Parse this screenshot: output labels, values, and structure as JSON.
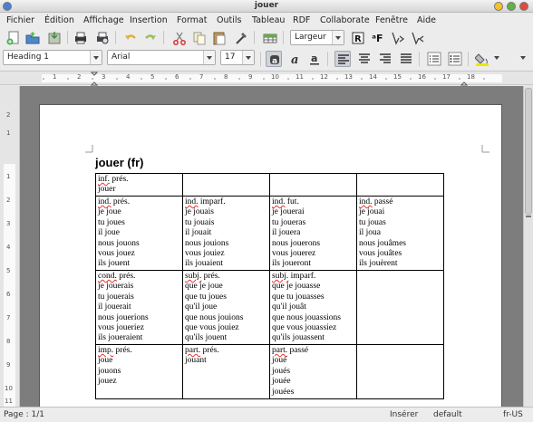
{
  "window": {
    "title": "jouer"
  },
  "menu": [
    "Fichier",
    "Édition",
    "Affichage",
    "Insertion",
    "Format",
    "Outils",
    "Tableau",
    "RDF",
    "Collaborate",
    "Fenêtre",
    "Aide"
  ],
  "toolbar": {
    "width_combo": "Largeur"
  },
  "format_toolbar": {
    "style": "Heading 1",
    "font": "Arial",
    "size": "17"
  },
  "ruler": {
    "h_labels": [
      "1",
      "2",
      "3",
      "4",
      "5",
      "6",
      "7",
      "8",
      "9",
      "10",
      "11",
      "12",
      "13",
      "14",
      "15",
      "16",
      "17",
      "18"
    ],
    "v_labels": [
      "2",
      "1",
      "1",
      "2",
      "3",
      "4",
      "5",
      "6",
      "7",
      "8",
      "9",
      "10",
      "11"
    ]
  },
  "document": {
    "heading_main": "jouer",
    "heading_lang": "(fr)",
    "rows": [
      [
        {
          "head": "inf. prés.",
          "lines": [
            "jouer"
          ]
        },
        {
          "head": "",
          "lines": []
        },
        {
          "head": "",
          "lines": []
        },
        {
          "head": "",
          "lines": []
        }
      ],
      [
        {
          "head": "ind. prés.",
          "lines": [
            "je joue",
            "tu joues",
            "il joue",
            "nous jouons",
            "vous jouez",
            "ils jouent"
          ]
        },
        {
          "head": "ind. imparf.",
          "lines": [
            "je jouais",
            "tu jouais",
            "il jouait",
            "nous jouions",
            "vous jouiez",
            "ils jouaient"
          ]
        },
        {
          "head": "ind. fut.",
          "lines": [
            "je jouerai",
            "tu joueras",
            "il jouera",
            "nous jouerons",
            "vous jouerez",
            "ils joueront"
          ]
        },
        {
          "head": "ind. passé",
          "lines": [
            "je jouai",
            "tu jouas",
            "il joua",
            "nous jouâmes",
            "vous jouâtes",
            "ils jouèrent"
          ]
        }
      ],
      [
        {
          "head": "cond. prés.",
          "lines": [
            "je jouerais",
            "tu jouerais",
            "il jouerait",
            "nous jouerions",
            "vous joueriez",
            "ils joueraient"
          ]
        },
        {
          "head": "subj. prés.",
          "lines": [
            "que je joue",
            "que tu joues",
            "qu'il joue",
            "que nous jouions",
            "que vous jouiez",
            "qu'ils jouent"
          ]
        },
        {
          "head": "subj. imparf.",
          "lines": [
            "que je jouasse",
            "que tu jouasses",
            "qu'il jouât",
            "que nous jouassions",
            "que vous jouassiez",
            "qu'ils jouassent"
          ]
        },
        {
          "head": "",
          "lines": []
        }
      ],
      [
        {
          "head": "imp. prés.",
          "lines": [
            "joue",
            "jouons",
            "jouez"
          ]
        },
        {
          "head": "part. prés.",
          "lines": [
            "jouant"
          ]
        },
        {
          "head": "part. passé",
          "lines": [
            "joué",
            "joués",
            "jouée",
            "jouées"
          ]
        },
        {
          "head": "",
          "lines": []
        }
      ]
    ]
  },
  "status": {
    "page": "Page : 1/1",
    "mode": "Insérer",
    "style": "default",
    "lang": "fr-US"
  }
}
